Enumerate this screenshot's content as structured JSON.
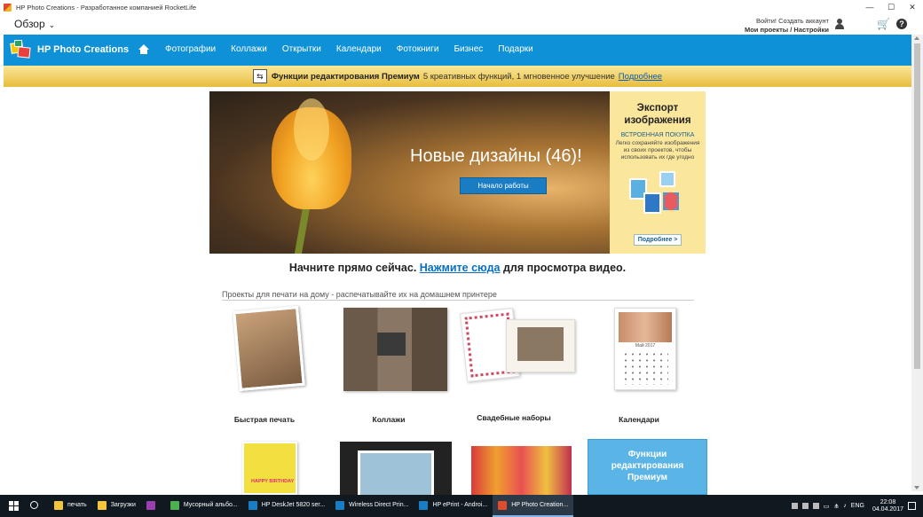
{
  "window": {
    "title": "HP Photo Creations - Разработанное компанией RocketLife",
    "controls": [
      "—",
      "☐",
      "✕"
    ]
  },
  "toolbar": {
    "overview_label": "Обзор",
    "login_text": "Войти! Создать аккаунт",
    "projects_text": "Мои проекты / Настройки",
    "help_label": "?"
  },
  "nav": {
    "brand": "HP Photo Creations",
    "items": [
      "Фотографии",
      "Коллажи",
      "Открытки",
      "Календари",
      "Фотокниги",
      "Бизнес",
      "Подарки"
    ]
  },
  "premium_bar": {
    "title": "Функции редактирования Премиум",
    "text": "5 креативных функций, 1 мгновенное улучшение",
    "link": "Подробнее"
  },
  "hero": {
    "title": "Новые дизайны (46)!",
    "button": "Начало работы"
  },
  "promo": {
    "title_line1": "Экспорт",
    "title_line2": "изображения",
    "subtitle": "ВСТРОЕННАЯ ПОКУПКА",
    "description": "Легко сохраняйте изображения из своих проектов, чтобы использовать их где угодно",
    "button": "Подробнее >"
  },
  "start": {
    "prefix": "Начните прямо сейчас.",
    "link": "Нажмите сюда",
    "suffix": "для просмотра видео."
  },
  "section": {
    "label": "Проекты для печати на дому - распечатывайте их на домашнем принтере"
  },
  "products": {
    "quick_print": "Быстрая печать",
    "collages": "Коллажи",
    "wedding": "Свадебные наборы",
    "calendars": "Календари",
    "calendar_month": "Май 2017",
    "birthday_card_text": "HAPPY BIRTHDAY"
  },
  "feature_tile": {
    "line1": "Функции",
    "line2": "редактирования",
    "line3": "Премиум"
  },
  "taskbar": {
    "items": [
      {
        "label": "печать",
        "icon_color": "#f3c53a",
        "active": false
      },
      {
        "label": "Загрузки",
        "icon_color": "#f3c53a",
        "active": false
      },
      {
        "label": "",
        "icon_color": "#9b3fb0",
        "active": false
      },
      {
        "label": "Мусорный альбо...",
        "icon_color": "#4caf50",
        "active": false
      },
      {
        "label": "HP DeskJet 5820 ser...",
        "icon_color": "#1a7cc2",
        "active": false
      },
      {
        "label": "Wireless Direct Prin...",
        "icon_color": "#1a7cc2",
        "active": false
      },
      {
        "label": "HP ePrint - Androi...",
        "icon_color": "#1a7cc2",
        "active": false
      },
      {
        "label": "HP Photo Creation...",
        "icon_color": "#e04b2b",
        "active": true
      }
    ],
    "lang": "ENG",
    "time": "22:08",
    "date": "04.04.2017"
  },
  "colors": {
    "nav_blue": "#0e91d7",
    "premium_gold": "#e8bd3d",
    "link_blue": "#0a6fc2",
    "feature_tile": "#5ab4e5"
  }
}
